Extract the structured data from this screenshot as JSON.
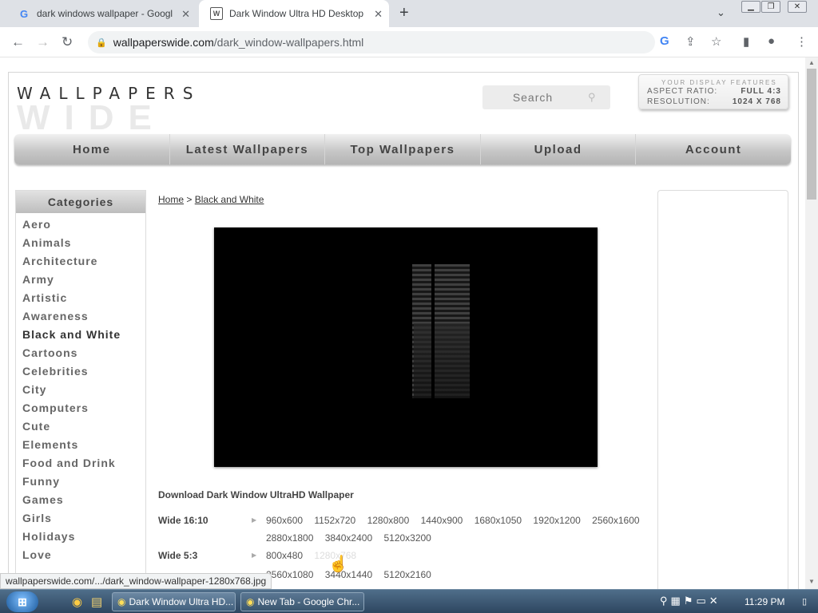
{
  "browser": {
    "tabs": [
      {
        "title": "dark windows wallpaper - Google",
        "favicon": "G"
      },
      {
        "title": "Dark Window Ultra HD Desktop",
        "favicon": "W"
      }
    ],
    "address": {
      "domain": "wallpaperswide.com",
      "path": "/dark_window-wallpapers.html"
    },
    "status_url": "wallpaperswide.com/.../dark_window-wallpaper-1280x768.jpg"
  },
  "site": {
    "logo_top": "WALLPAPERS",
    "logo_bottom": "WIDE",
    "search_placeholder": "Search",
    "display": {
      "header": "YOUR DISPLAY FEATURES",
      "aspect_label": "ASPECT RATIO:",
      "aspect_value": "FULL 4:3",
      "resolution_label": "RESOLUTION:",
      "resolution_value": "1024 X 768"
    },
    "nav": [
      "Home",
      "Latest Wallpapers",
      "Top Wallpapers",
      "Upload",
      "Account"
    ],
    "categories_title": "Categories",
    "categories": [
      "Aero",
      "Animals",
      "Architecture",
      "Army",
      "Artistic",
      "Awareness",
      "Black and White",
      "Cartoons",
      "Celebrities",
      "City",
      "Computers",
      "Cute",
      "Elements",
      "Food and Drink",
      "Funny",
      "Games",
      "Girls",
      "Holidays",
      "Love"
    ],
    "active_category": "Black and White",
    "breadcrumb": {
      "home": "Home",
      "sep": ">",
      "current": "Black and White"
    },
    "download_title": "Download Dark Window UltraHD Wallpaper",
    "resolutions": [
      {
        "label": "Wide 16:10",
        "links": [
          "960x600",
          "1152x720",
          "1280x800",
          "1440x900",
          "1680x1050",
          "1920x1200",
          "2560x1600"
        ]
      },
      {
        "label": "",
        "links": [
          "2880x1800",
          "3840x2400",
          "5120x3200"
        ]
      },
      {
        "label": "Wide 5:3",
        "links": [
          "800x480",
          "1280x768"
        ]
      },
      {
        "label": "",
        "links": [
          "2560x1080",
          "3440x1440",
          "5120x2160"
        ]
      }
    ]
  },
  "taskbar": {
    "tasks": [
      "Dark Window Ultra HD...",
      "New Tab - Google Chr..."
    ],
    "clock": "11:29 PM"
  }
}
